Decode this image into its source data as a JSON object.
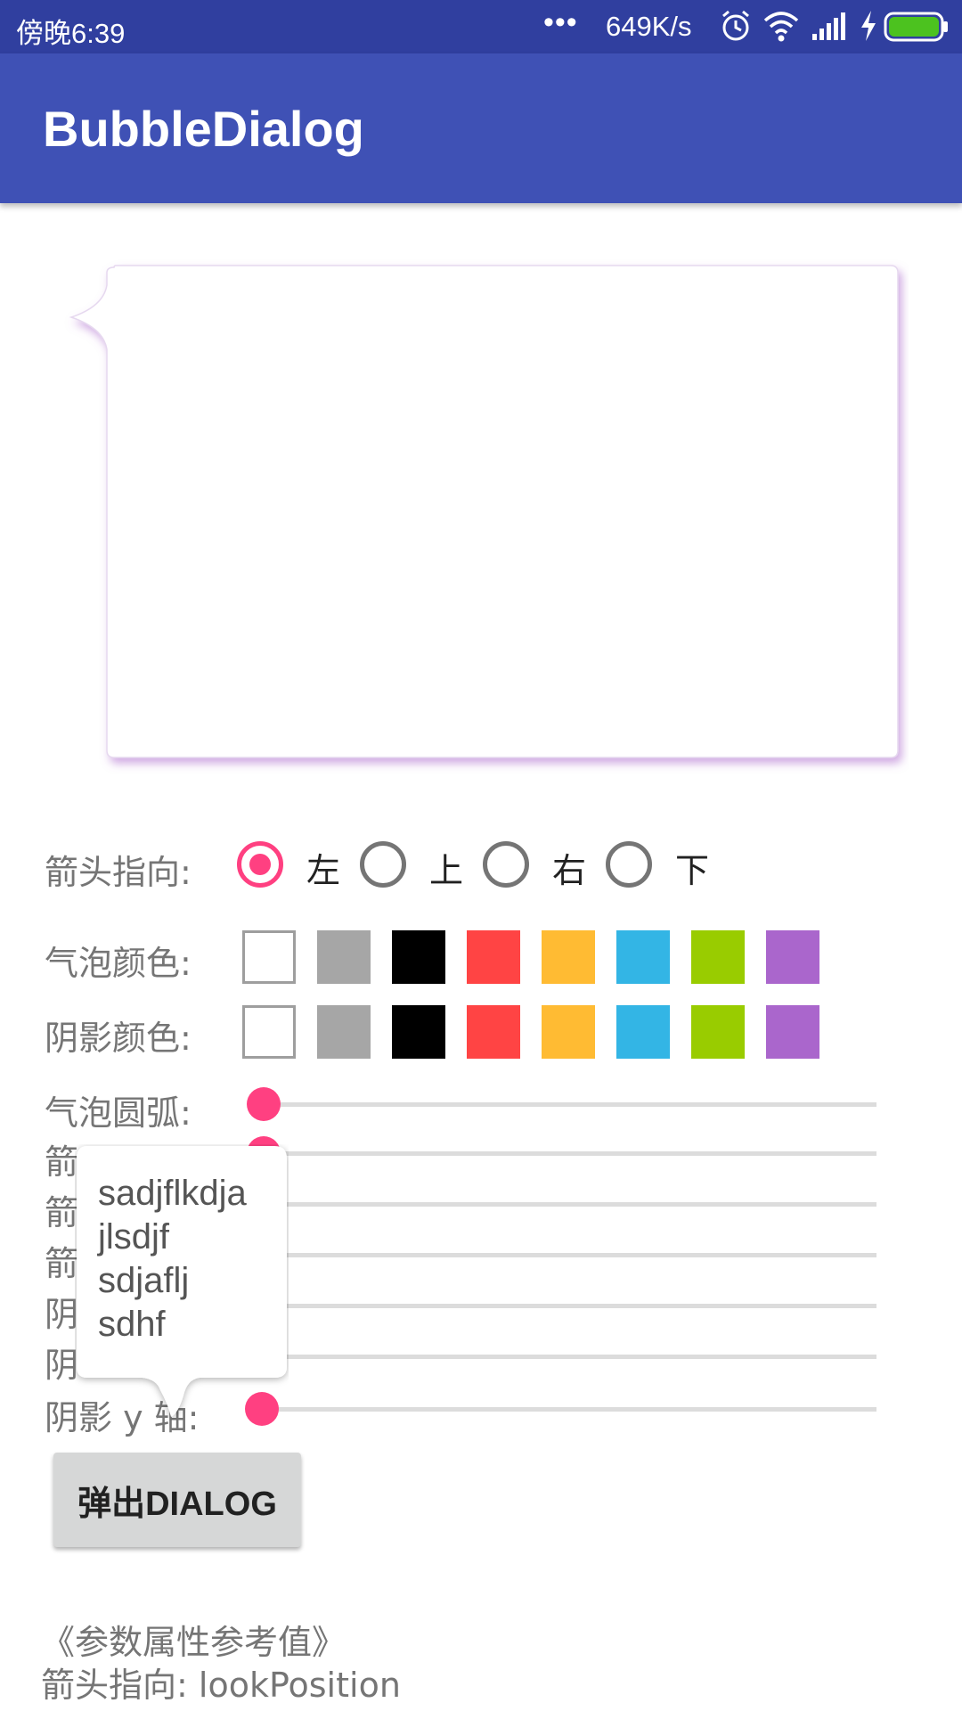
{
  "status_bar": {
    "time": "傍晚6:39",
    "more": "•••",
    "speed": "649K/s",
    "icons": [
      "alarm-icon",
      "wifi-icon",
      "signal-icon",
      "charging-icon",
      "battery-icon"
    ],
    "battery_color": "#4cc21f"
  },
  "app_bar": {
    "title": "BubbleDialog",
    "color": "#3f51b5"
  },
  "arrow_direction": {
    "label": "箭头指向:",
    "options": [
      "左",
      "上",
      "右",
      "下"
    ],
    "selected": "左"
  },
  "bubble_color": {
    "label": "气泡颜色:",
    "swatches": [
      "#ffffff",
      "#a6a6a6",
      "#000000",
      "#ff4444",
      "#ffbb33",
      "#33b5e5",
      "#99cc00",
      "#aa66cc"
    ]
  },
  "shadow_color": {
    "label": "阴影颜色:",
    "swatches": [
      "#ffffff",
      "#a6a6a6",
      "#000000",
      "#ff4444",
      "#ffbb33",
      "#33b5e5",
      "#99cc00",
      "#aa66cc"
    ]
  },
  "sliders": [
    {
      "label": "气泡圆弧:",
      "value": 0
    },
    {
      "label": "箭",
      "value": 0
    },
    {
      "label": "箭",
      "value": 0
    },
    {
      "label": "箭",
      "value": 0
    },
    {
      "label": "阴",
      "value": 0
    },
    {
      "label": "阴",
      "value": 0
    },
    {
      "label": "阴影 y 轴:",
      "value": 0
    }
  ],
  "popup": {
    "lines": [
      "sadjflkdja",
      "jlsdjf",
      "sdjaflj",
      "sdhf"
    ]
  },
  "button": {
    "label": "弹出DIALOG"
  },
  "reference": {
    "heading": "《参数属性参考值》",
    "line1": "箭头指向: lookPosition"
  },
  "accent_color": "#ff4081"
}
